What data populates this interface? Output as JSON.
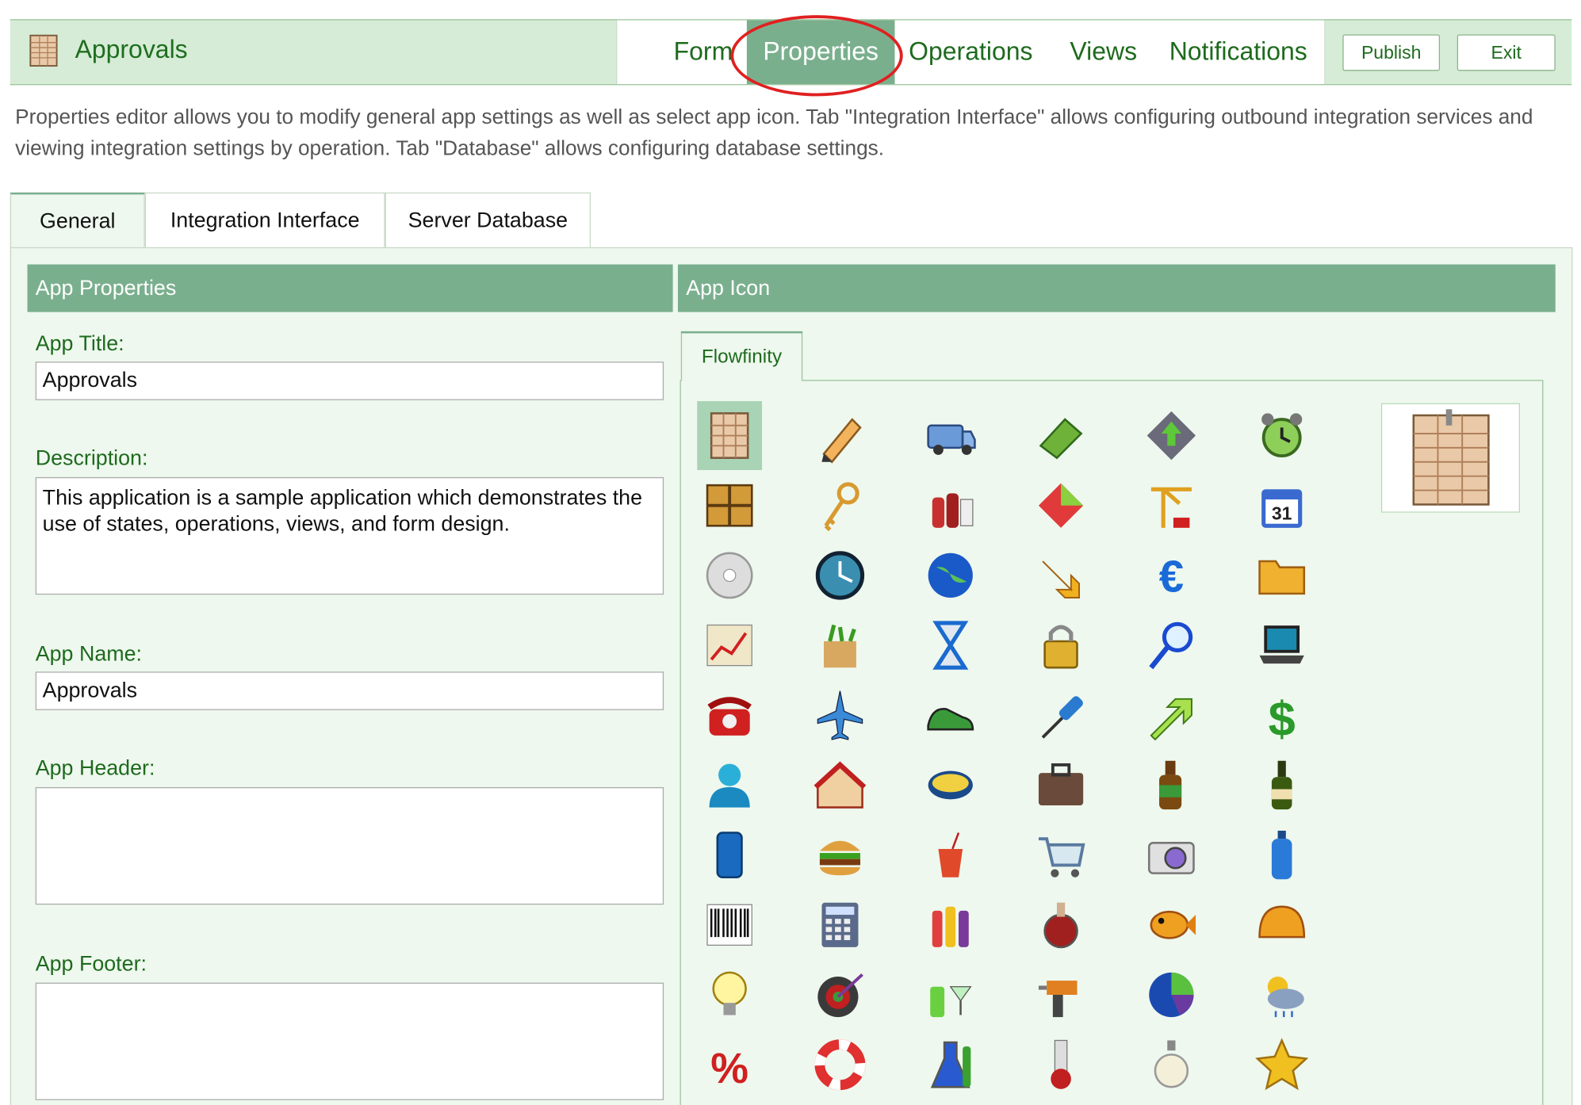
{
  "app": {
    "title": "Approvals",
    "logo_icon": "ledger-icon"
  },
  "nav": {
    "tabs": [
      {
        "label": "Form"
      },
      {
        "label": "Properties",
        "active": true
      },
      {
        "label": "Operations"
      },
      {
        "label": "Views"
      },
      {
        "label": "Notifications"
      }
    ],
    "publish_label": "Publish",
    "exit_label": "Exit"
  },
  "intro": "Properties editor allows you to modify general app settings as well as select app icon. Tab \"Integration Interface\" allows configuring outbound integration services and viewing integration settings by operation. Tab \"Database\" allows configuring database settings.",
  "tabs": [
    {
      "label": "General",
      "active": true
    },
    {
      "label": "Integration Interface"
    },
    {
      "label": "Server Database"
    }
  ],
  "app_properties": {
    "heading": "App Properties",
    "title_label": "App Title:",
    "title_value": "Approvals",
    "description_label": "Description:",
    "description_value": "This application is a sample application which demonstrates the use of states, operations, views, and form design.",
    "name_label": "App Name:",
    "name_value": "Approvals",
    "header_label": "App Header:",
    "header_value": "",
    "footer_label": "App Footer:",
    "footer_value": ""
  },
  "app_icon": {
    "heading": "App Icon",
    "library_tab": "Flowfinity",
    "selected_icon": "ledger-icon",
    "icons": [
      "ledger-icon",
      "pencil-icon",
      "delivery-van-icon",
      "eraser-icon",
      "upload-arrow-icon",
      "alarm-clock-icon",
      "cabinet-icon",
      "keys-icon",
      "ketchup-bottles-icon",
      "tag-icon",
      "crane-icon",
      "calendar-icon",
      "cd-icon",
      "clock-icon",
      "globe-icon",
      "arrow-down-right-icon",
      "euro-icon",
      "folder-icon",
      "line-chart-icon",
      "grocery-bag-icon",
      "hourglass-icon",
      "padlock-icon",
      "magnifier-icon",
      "laptop-icon",
      "telephone-icon",
      "airplane-icon",
      "sneaker-icon",
      "syringe-icon",
      "arrow-up-right-icon",
      "dollar-icon",
      "user-icon",
      "house-icon",
      "bowl-icon",
      "briefcase-icon",
      "beer-bottle-icon",
      "wine-bottle-icon",
      "soda-can-icon",
      "burger-icon",
      "drink-cup-icon",
      "shopping-cart-icon",
      "camera-icon",
      "water-bottle-icon",
      "barcode-icon",
      "calculator-icon",
      "bottles-icon",
      "potion-icon",
      "fish-icon",
      "hard-hat-icon",
      "light-bulb-icon",
      "dartboard-icon",
      "cocktail-icon",
      "drill-icon",
      "pie-chart-icon",
      "weather-icon",
      "percent-icon",
      "life-ring-icon",
      "flask-icon",
      "test-tube-icon",
      "perfume-icon",
      "star-icon"
    ],
    "colors": {
      "green": "#1e6a1e",
      "accent": "#7aaf8e",
      "highlight": "#e02020"
    }
  }
}
